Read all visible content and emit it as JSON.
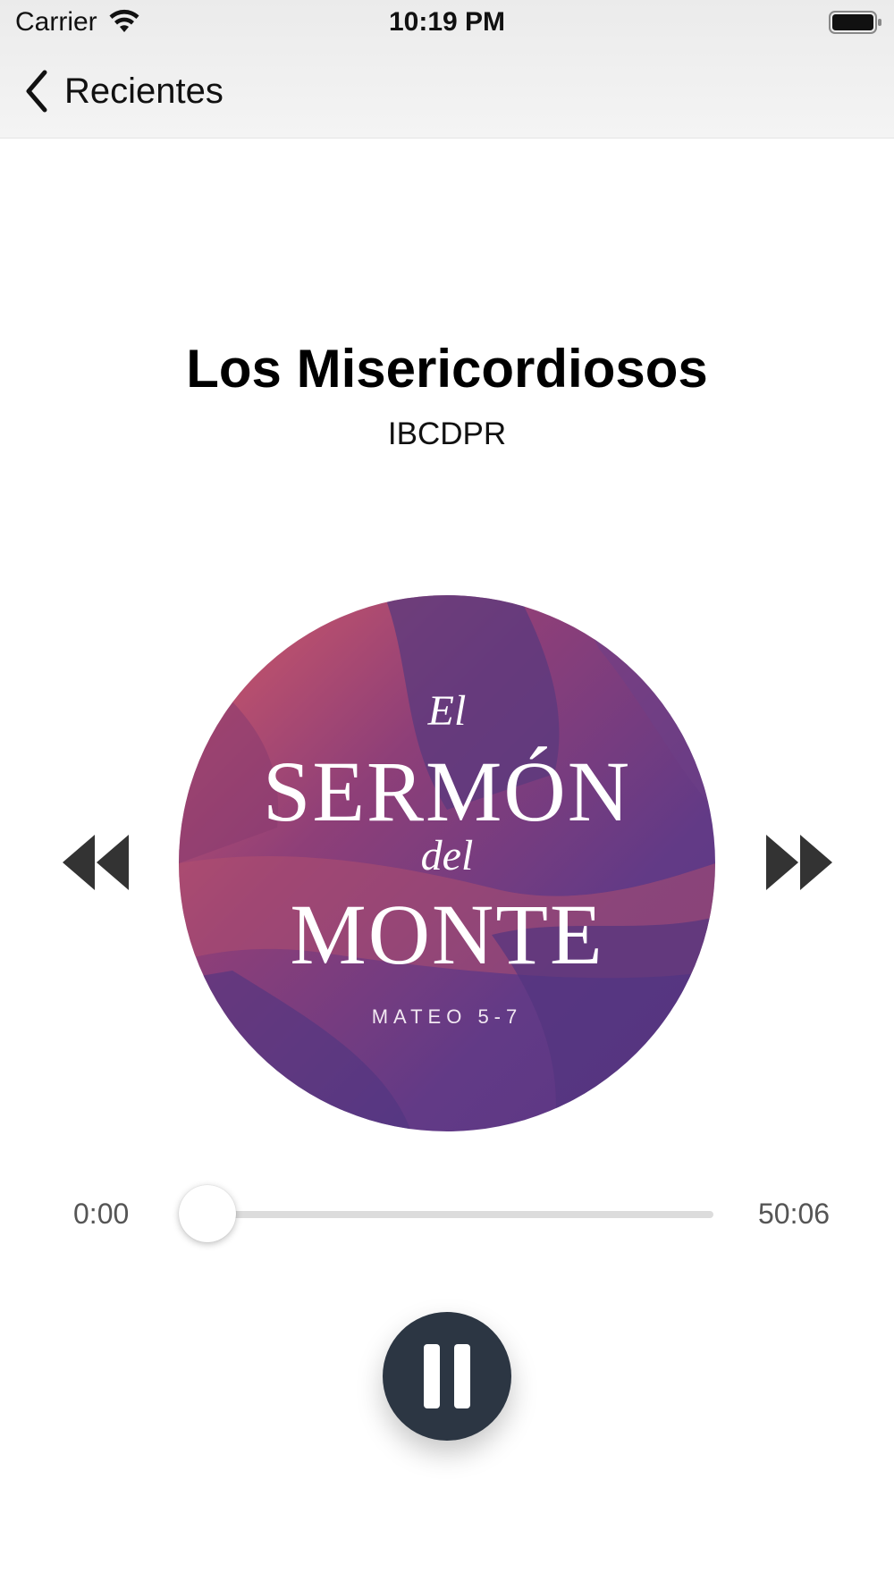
{
  "status_bar": {
    "carrier": "Carrier",
    "time": "10:19 PM",
    "icons": [
      "wifi-icon",
      "battery-icon"
    ]
  },
  "nav": {
    "back_label": "Recientes",
    "back_icon": "chevron-left-icon"
  },
  "episode": {
    "title": "Los Misericordiosos",
    "author": "IBCDPR"
  },
  "artwork": {
    "line1": "El",
    "line2": "SERMÓN",
    "line3": "del",
    "line4": "MONTE",
    "line5": "MATEO 5-7"
  },
  "controls": {
    "rewind_icon": "rewind-icon",
    "forward_icon": "fast-forward-icon",
    "pause_icon": "pause-icon"
  },
  "progress": {
    "elapsed": "0:00",
    "total": "50:06",
    "fraction": 0.0
  },
  "colors": {
    "accent": "#2c3643",
    "artwork_purple": "#6a3a85",
    "artwork_red": "#d45a67"
  }
}
